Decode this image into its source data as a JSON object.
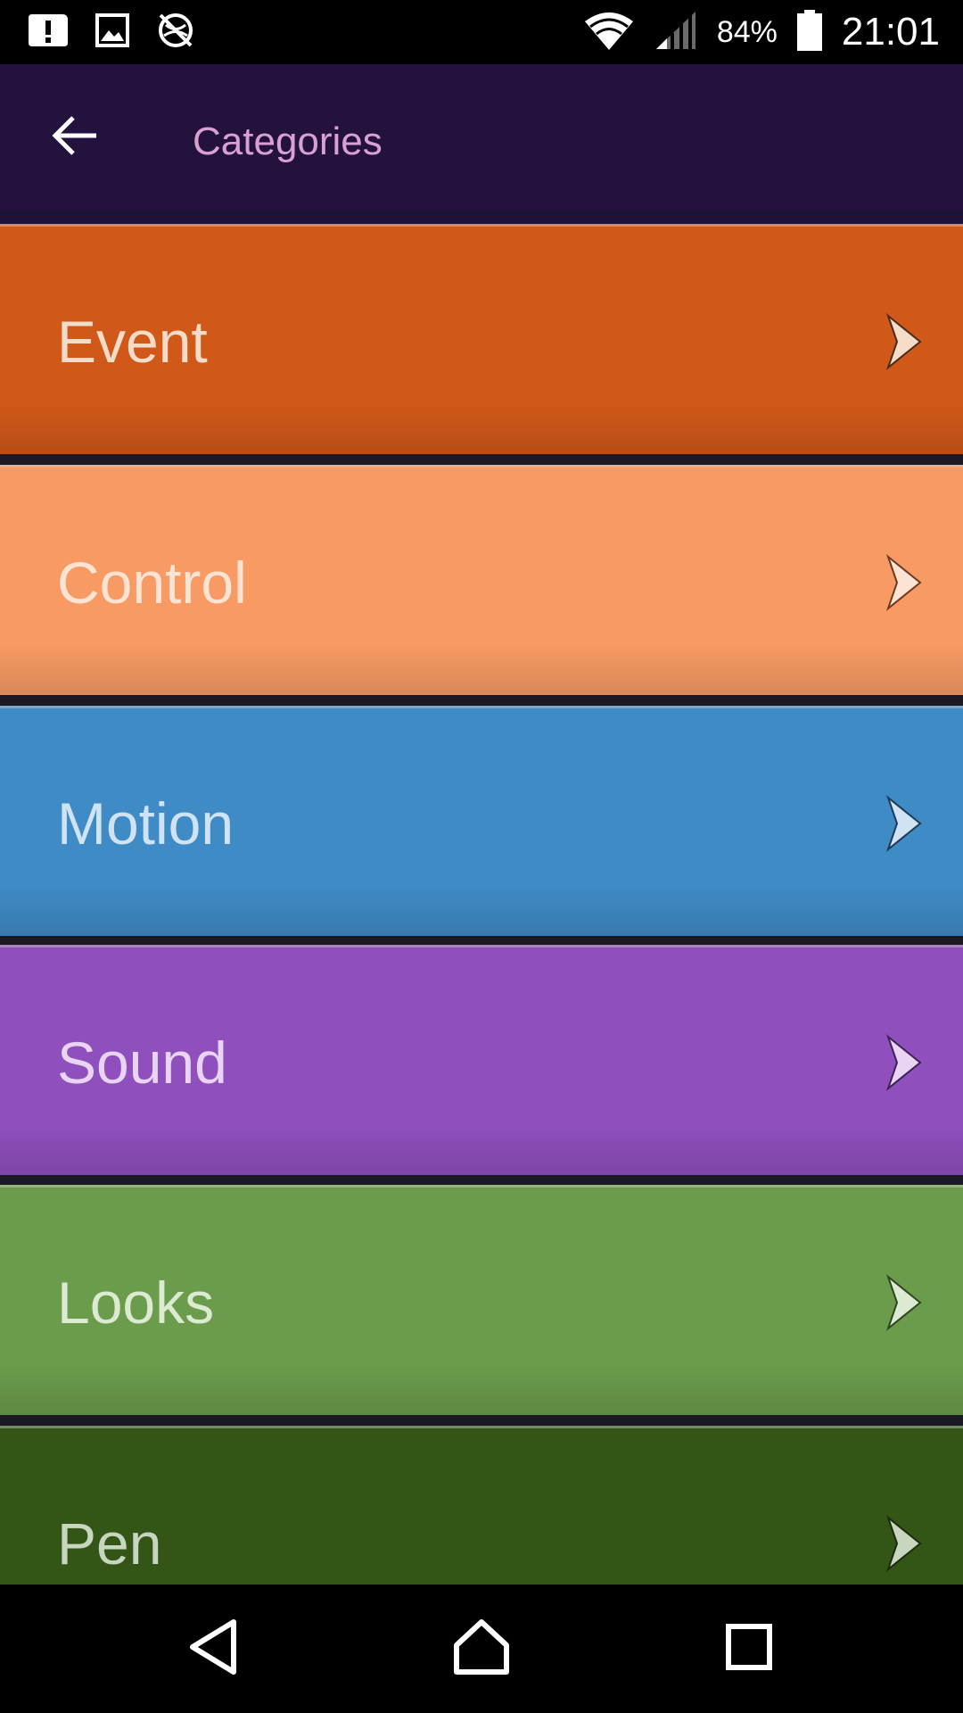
{
  "status_bar": {
    "left_icons": [
      "sd-card-alert-icon",
      "image-icon",
      "no-location-icon"
    ],
    "battery_pct": "84%",
    "time": "21:01"
  },
  "app_bar": {
    "title": "Categories",
    "back_icon": "arrow-back-icon"
  },
  "categories": [
    {
      "label": "Event",
      "color": "#d05819",
      "text_color": "#f4dcc8"
    },
    {
      "label": "Control",
      "color": "#f79a63",
      "text_color": "#fde3d2"
    },
    {
      "label": "Motion",
      "color": "#3f8bc6",
      "text_color": "#cfe3f4"
    },
    {
      "label": "Sound",
      "color": "#8f4fbd",
      "text_color": "#ead4f4"
    },
    {
      "label": "Looks",
      "color": "#6a9c4b",
      "text_color": "#dbead0"
    },
    {
      "label": "Pen",
      "color": "#335617",
      "text_color": "#c9d6bf"
    }
  ],
  "nav_bar": {
    "back": "nav-back-icon",
    "home": "nav-home-icon",
    "recents": "nav-recents-icon"
  }
}
